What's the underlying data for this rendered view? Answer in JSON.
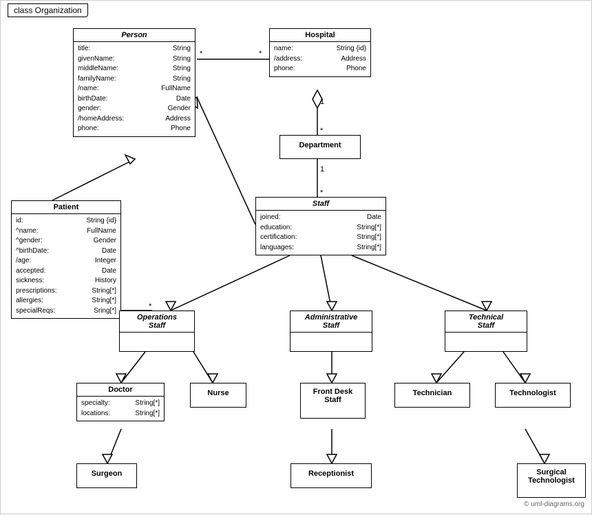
{
  "title": "class Organization",
  "copyright": "© uml-diagrams.org",
  "classes": {
    "person": {
      "name": "Person",
      "italic": true,
      "attrs": [
        [
          "title:",
          "String"
        ],
        [
          "givenName:",
          "String"
        ],
        [
          "middleName:",
          "String"
        ],
        [
          "familyName:",
          "String"
        ],
        [
          "/name:",
          "FullName"
        ],
        [
          "birthDate:",
          "Date"
        ],
        [
          "gender:",
          "Gender"
        ],
        [
          "/homeAddress:",
          "Address"
        ],
        [
          "phone:",
          "Phone"
        ]
      ]
    },
    "hospital": {
      "name": "Hospital",
      "italic": false,
      "attrs": [
        [
          "name:",
          "String {id}"
        ],
        [
          "/address:",
          "Address"
        ],
        [
          "phone:",
          "Phone"
        ]
      ]
    },
    "patient": {
      "name": "Patient",
      "italic": false,
      "attrs": [
        [
          "id:",
          "String {id}"
        ],
        [
          "^name:",
          "FullName"
        ],
        [
          "^gender:",
          "Gender"
        ],
        [
          "^birthDate:",
          "Date"
        ],
        [
          "/age:",
          "Integer"
        ],
        [
          "accepted:",
          "Date"
        ],
        [
          "sickness:",
          "History"
        ],
        [
          "prescriptions:",
          "String[*]"
        ],
        [
          "allergies:",
          "String[*]"
        ],
        [
          "specialReqs:",
          "Sring[*]"
        ]
      ]
    },
    "department": {
      "name": "Department",
      "italic": false,
      "attrs": []
    },
    "staff": {
      "name": "Staff",
      "italic": true,
      "attrs": [
        [
          "joined:",
          "Date"
        ],
        [
          "education:",
          "String[*]"
        ],
        [
          "certification:",
          "String[*]"
        ],
        [
          "languages:",
          "String[*]"
        ]
      ]
    },
    "operations_staff": {
      "name": "Operations\nStaff",
      "italic": true,
      "attrs": []
    },
    "administrative_staff": {
      "name": "Administrative\nStaff",
      "italic": true,
      "attrs": []
    },
    "technical_staff": {
      "name": "Technical\nStaff",
      "italic": true,
      "attrs": []
    },
    "doctor": {
      "name": "Doctor",
      "italic": false,
      "attrs": [
        [
          "specialty:",
          "String[*]"
        ],
        [
          "locations:",
          "String[*]"
        ]
      ]
    },
    "nurse": {
      "name": "Nurse",
      "italic": false,
      "attrs": []
    },
    "front_desk_staff": {
      "name": "Front Desk\nStaff",
      "italic": false,
      "attrs": []
    },
    "technician": {
      "name": "Technician",
      "italic": false,
      "attrs": []
    },
    "technologist": {
      "name": "Technologist",
      "italic": false,
      "attrs": []
    },
    "surgeon": {
      "name": "Surgeon",
      "italic": false,
      "attrs": []
    },
    "receptionist": {
      "name": "Receptionist",
      "italic": false,
      "attrs": []
    },
    "surgical_technologist": {
      "name": "Surgical\nTechnologist",
      "italic": false,
      "attrs": []
    }
  }
}
